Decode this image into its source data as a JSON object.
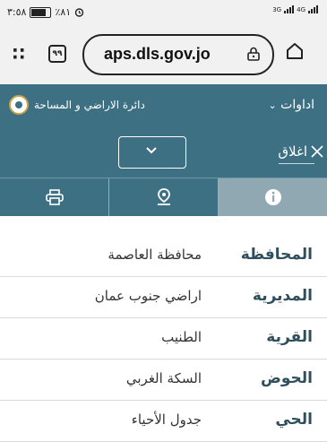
{
  "status_bar": {
    "time": "٣:٥٨",
    "battery": "٪٨١",
    "net1": "3G",
    "net2": "4G"
  },
  "browser": {
    "url": "aps.dls.gov.jo",
    "tab_count": "٩٩"
  },
  "site": {
    "tools_label": "اداوات",
    "department": "دائرة الاراضي و المساحة"
  },
  "panel": {
    "close_label": "اغلاق",
    "tabs": [
      {
        "icon": "info-icon",
        "active": true
      },
      {
        "icon": "location-pin-icon",
        "active": false
      },
      {
        "icon": "printer-icon",
        "active": false
      }
    ],
    "rows": [
      {
        "label": "المحافظة",
        "value": "محافظة العاصمة"
      },
      {
        "label": "المديرية",
        "value": "اراضي جنوب عمان"
      },
      {
        "label": "القرية",
        "value": "الطنيب"
      },
      {
        "label": "الحوض",
        "value": "السكة الغربي"
      },
      {
        "label": "الحي",
        "value": "جدول الأحياء"
      }
    ]
  },
  "colors": {
    "header": "#3d7083",
    "active_tab": "#8fa8b2",
    "label_text": "#2f4f5c"
  }
}
